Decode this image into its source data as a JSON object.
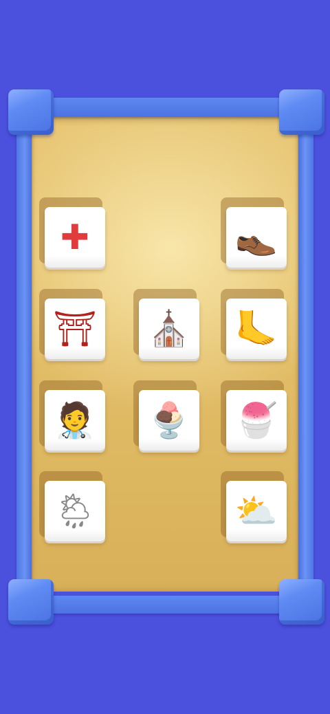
{
  "board": {
    "frame_color": "#5b86ef",
    "background_color": "#4b50dd",
    "tray_color": "#e3be68"
  },
  "tiles": [
    {
      "icon": "red-cross-icon",
      "glyph": "✚",
      "glyph_color": "#e23b3b"
    },
    {
      "icon": "leather-shoe-icon",
      "glyph": "👞",
      "glyph_color": "#8a3a1a"
    },
    {
      "icon": "torii-gate-icon",
      "glyph": "⛩",
      "glyph_color": "#b0231c"
    },
    {
      "icon": "church-icon",
      "glyph": "⛪",
      "glyph_color": "#3b3b3b"
    },
    {
      "icon": "footprint-icon",
      "glyph": "🦶",
      "glyph_color": "#f3b626"
    },
    {
      "icon": "health-worker-icon",
      "glyph": "🧑‍⚕️",
      "glyph_color": "#6b5a4a"
    },
    {
      "icon": "ice-cream-icon",
      "glyph": "🍨",
      "glyph_color": "#c89a55"
    },
    {
      "icon": "shaved-ice-icon",
      "glyph": "🍧",
      "glyph_color": "#e8506a"
    },
    {
      "icon": "sun-behind-rain-cloud-icon",
      "glyph": "🌦",
      "glyph_color": "#888888"
    },
    {
      "icon": "sun-behind-cloud-icon",
      "glyph": "⛅",
      "glyph_color": "#f4c21b"
    }
  ]
}
